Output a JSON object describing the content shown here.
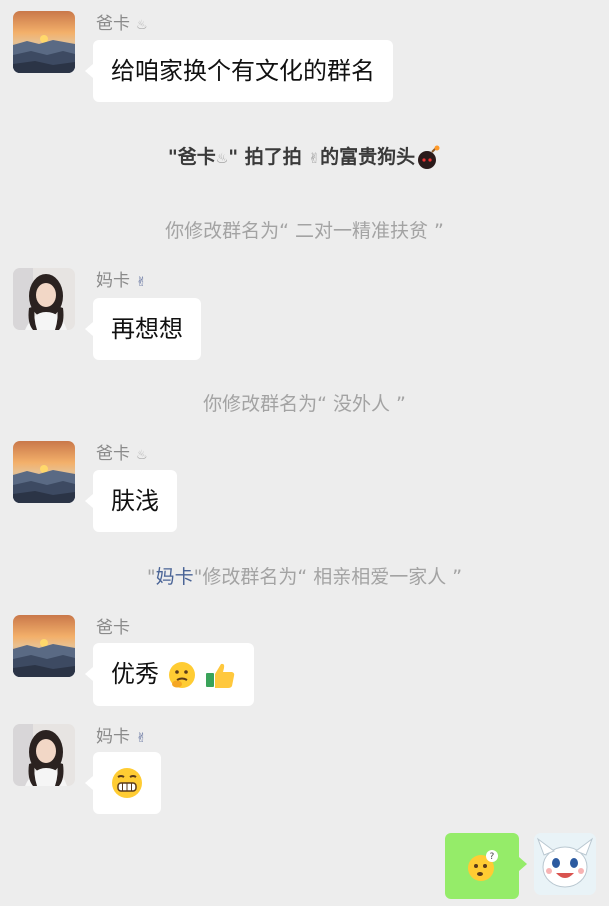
{
  "messages": [
    {
      "sender": "爸卡",
      "sender_tag": "♨",
      "text": "给咱家换个有文化的群名"
    },
    {
      "sender": "妈卡",
      "sender_tag": "✌",
      "text": "再想想"
    },
    {
      "sender": "爸卡",
      "sender_tag": "♨",
      "text": "肤浅"
    },
    {
      "sender": "爸卡",
      "text": "优秀"
    },
    {
      "sender": "妈卡",
      "sender_tag": "✌"
    }
  ],
  "system": {
    "pat": {
      "open": "\"爸卡",
      "tag": "♨",
      "rest": "\" 拍了拍 ",
      "icon": "✌",
      "tail": "的富贵狗头"
    },
    "rename1": "你修改群名为“ 二对一精准扶贫 ”",
    "rename2": "你修改群名为“ 没外人 ”",
    "rename3": {
      "q_open": "\"",
      "name": "妈卡",
      "rest": "\"修改群名为“ 相亲相爱一家人 ”"
    }
  },
  "icons": {
    "dad_avatar": "sunset-mountain-avatar",
    "mom_avatar": "girl-photo-avatar",
    "self_avatar": "cartoon-character-avatar"
  },
  "colors": {
    "self_bubble": "#95ec69",
    "other_bubble": "#ffffff",
    "background": "#ededed"
  }
}
